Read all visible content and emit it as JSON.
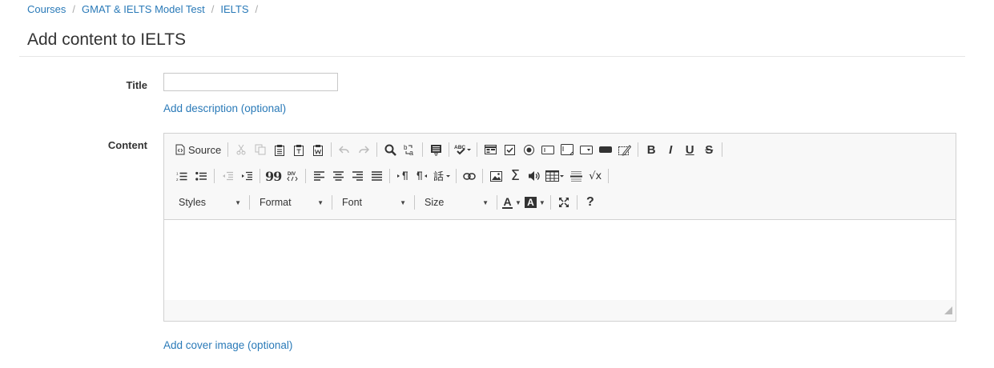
{
  "breadcrumb": {
    "items": [
      "Courses",
      "GMAT & IELTS Model Test",
      "IELTS"
    ],
    "separator": "/"
  },
  "page": {
    "title": "Add content to IELTS"
  },
  "form": {
    "title_label": "Title",
    "title_value": "",
    "add_description_link": "Add description (optional)",
    "content_label": "Content",
    "add_cover_link": "Add cover image (optional)"
  },
  "editor": {
    "source_label": "Source",
    "dropdowns": {
      "styles": "Styles",
      "format": "Format",
      "font": "Font",
      "size": "Size"
    },
    "toolbar_icons": [
      "source-icon",
      "cut-icon",
      "copy-icon",
      "paste-icon",
      "paste-text-icon",
      "paste-word-icon",
      "undo-icon",
      "redo-icon",
      "find-icon",
      "replace-icon",
      "select-all-icon",
      "spellcheck-icon",
      "form-icon",
      "checkbox-icon",
      "radio-icon",
      "textfield-icon",
      "textarea-icon",
      "select-icon",
      "button-icon",
      "hidden-field-icon",
      "bold-icon",
      "italic-icon",
      "underline-icon",
      "strike-icon",
      "numbered-list-icon",
      "bulleted-list-icon",
      "outdent-icon",
      "indent-icon",
      "blockquote-icon",
      "div-icon",
      "align-left-icon",
      "align-center-icon",
      "align-right-icon",
      "justify-icon",
      "ltr-icon",
      "rtl-icon",
      "language-icon",
      "link-icon",
      "image-icon",
      "equation-icon",
      "audio-icon",
      "table-icon",
      "horizontal-rule-icon",
      "sqrt-icon",
      "text-color-icon",
      "bg-color-icon",
      "maximize-icon",
      "help-icon",
      "resize-icon"
    ],
    "glyphs": {
      "bold": "B",
      "italic": "I",
      "underline": "U",
      "strike": "S",
      "blockquote": "99",
      "equation": "Σ",
      "sqrt": "√x",
      "help": "?",
      "text_color": "A",
      "bg_color": "A"
    },
    "colors": {
      "link": "#2a7ab8",
      "toolbar_bg": "#f8f8f8",
      "border": "#d1d1d1"
    }
  }
}
